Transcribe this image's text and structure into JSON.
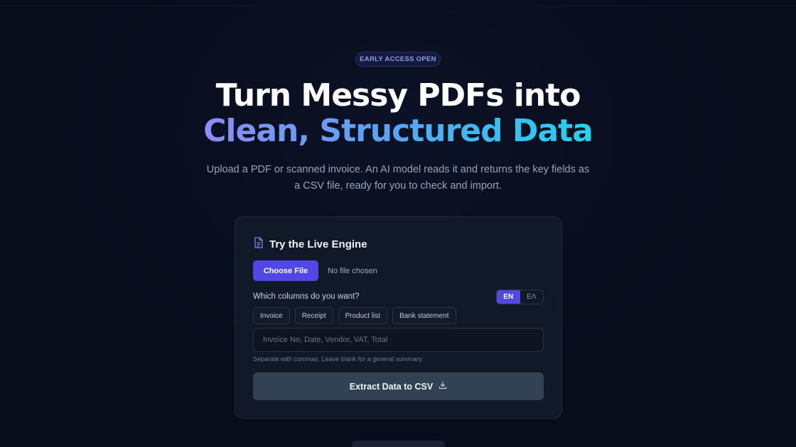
{
  "badge": "EARLY ACCESS OPEN",
  "hero": {
    "line1": "Turn Messy PDFs into",
    "line2": "Clean, Structured Data",
    "subtitle": "Upload a PDF or scanned invoice. An AI model reads it and returns the key fields as a CSV file, ready for you to check and import."
  },
  "card": {
    "title": "Try the Live Engine",
    "title_icon": "document-icon",
    "file_button": "Choose File",
    "file_status": "No file chosen",
    "columns_label": "Which columns do you want?",
    "languages": [
      {
        "label": "EN",
        "active": true
      },
      {
        "label": "EΛ",
        "active": false
      }
    ],
    "presets": [
      "Invoice",
      "Receipt",
      "Product list",
      "Bank statement"
    ],
    "columns_input": {
      "value": "",
      "placeholder": "Invoice No, Date, Vendor, VAT, Total"
    },
    "hint": "Separate with commas. Leave blank for a general summary.",
    "extract_button": "Extract Data to CSV",
    "extract_icon": "download-icon"
  },
  "colors": {
    "background": "#080c1b",
    "accent": "#5146e6",
    "gradient_start": "#8b8df7",
    "gradient_end": "#22d3ee",
    "card": "#111827"
  }
}
